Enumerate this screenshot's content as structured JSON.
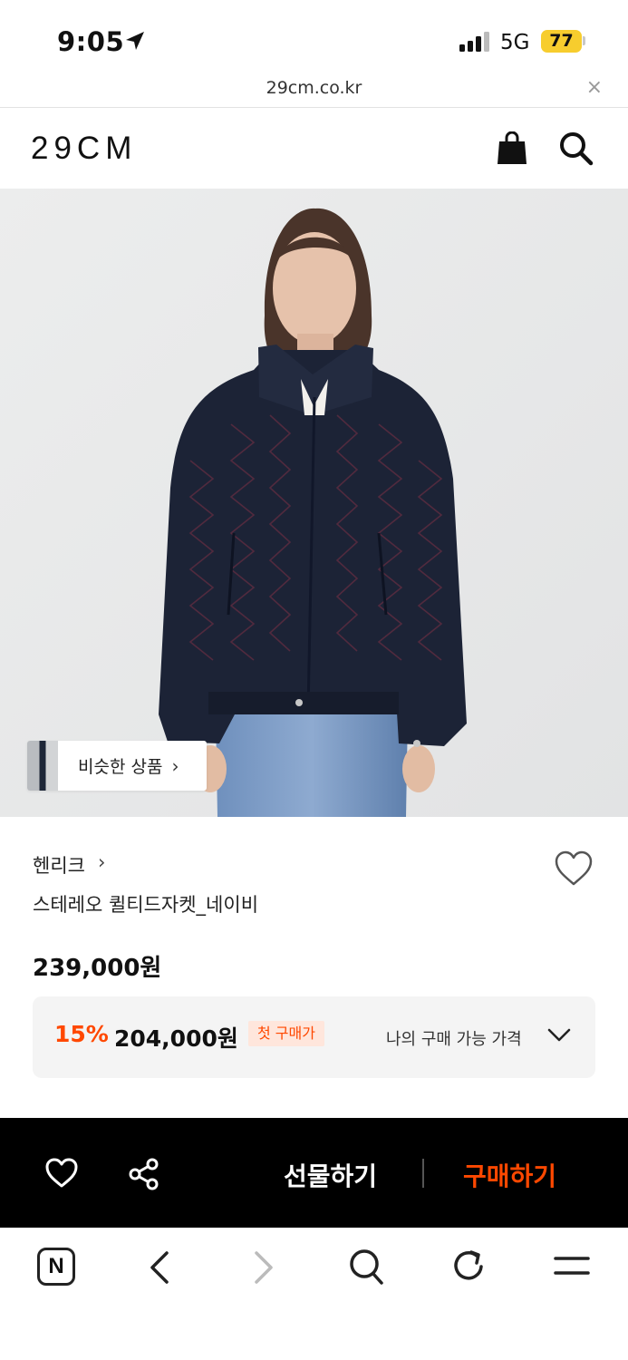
{
  "status_bar": {
    "time": "9:05",
    "network": "5G",
    "battery": "77"
  },
  "browser": {
    "url": "29cm.co.kr",
    "close_label": "×"
  },
  "header": {
    "logo": "29CM"
  },
  "hero": {
    "similar_label": "비슷한 상품",
    "similar_chevron": "›"
  },
  "product": {
    "brand": "헨리크",
    "brand_chevron": "›",
    "name": "스테레오 퀼티드자켓_네이비",
    "price": "239,000원",
    "discount_percent": "15%",
    "discount_price": "204,000원",
    "first_purchase_badge": "첫 구매가",
    "my_price_label": "나의 구매 가능 가격"
  },
  "action_bar": {
    "gift_label": "선물하기",
    "buy_label": "구매하기"
  },
  "toolbar": {
    "n_label": "N"
  },
  "colors": {
    "accent": "#ff4800",
    "badge_bg": "#ffe6dc",
    "battery": "#f7cd2e"
  }
}
